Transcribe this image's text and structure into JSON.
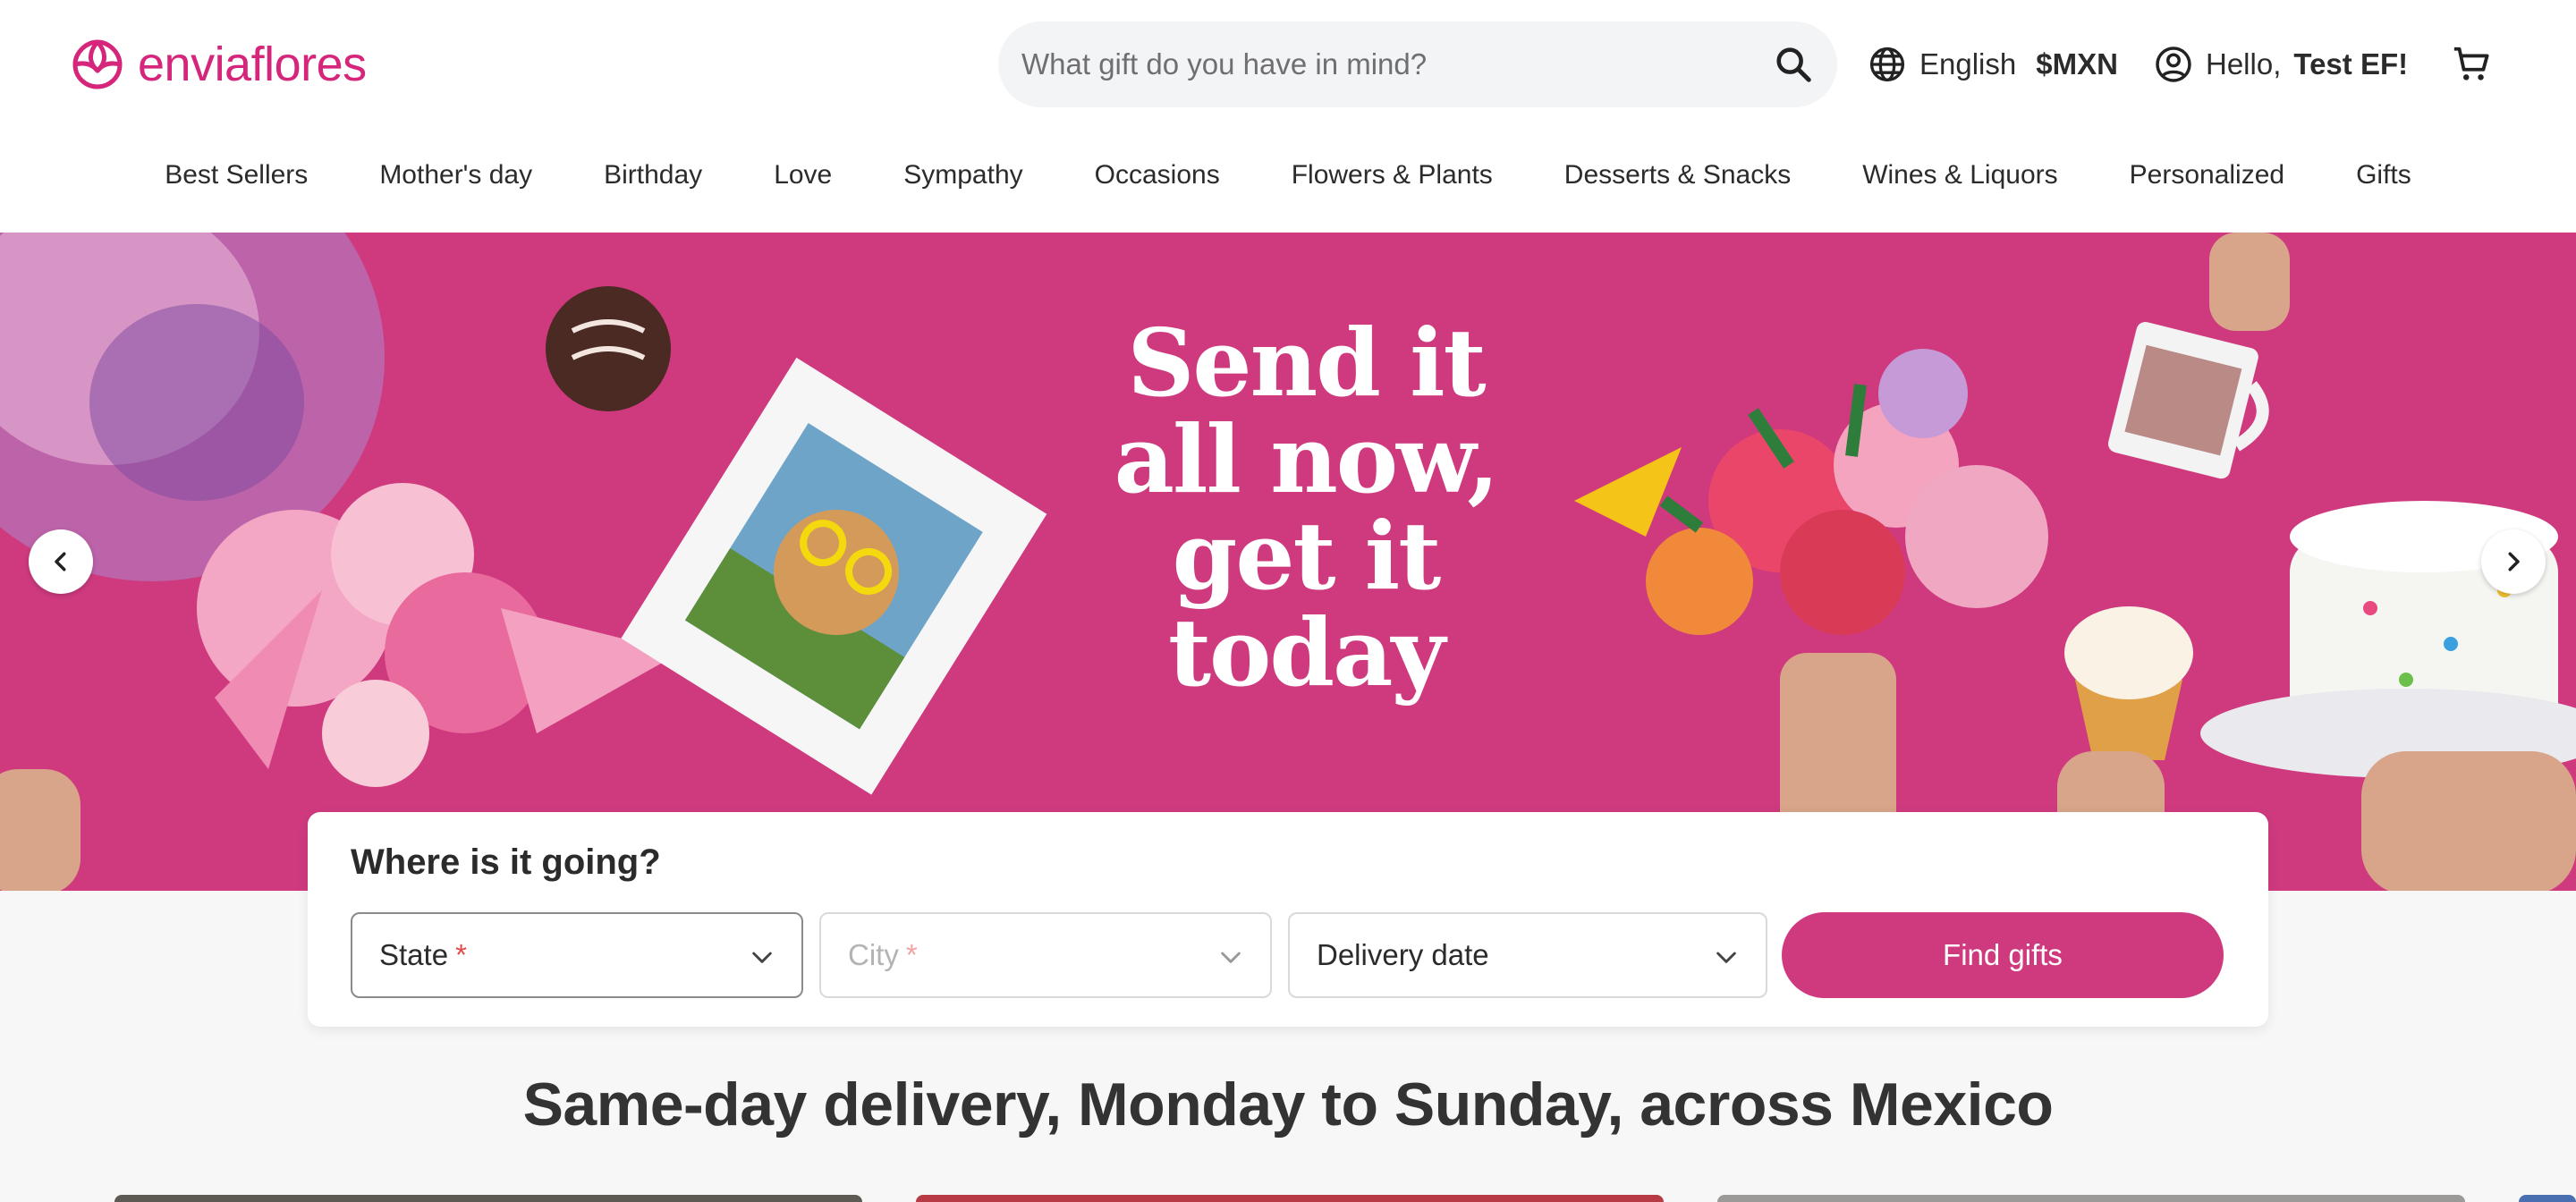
{
  "brand": {
    "name": "enviaflores",
    "color": "#d5267b"
  },
  "search": {
    "placeholder": "What gift do you have in mind?"
  },
  "locale": {
    "language": "English",
    "currency": "$MXN"
  },
  "user": {
    "greeting": "Hello,",
    "name": "Test EF!"
  },
  "nav": {
    "items": [
      "Best Sellers",
      "Mother's day",
      "Birthday",
      "Love",
      "Sympathy",
      "Occasions",
      "Flowers & Plants",
      "Desserts & Snacks",
      "Wines & Liquors",
      "Personalized",
      "Gifts"
    ]
  },
  "hero": {
    "lines": [
      "Send it",
      "all now,",
      "get it",
      "today"
    ],
    "background": "#cf3a7f"
  },
  "delivery": {
    "title": "Where is it going?",
    "state_label": "State",
    "city_label": "City",
    "required_mark": "*",
    "date_label": "Delivery date",
    "button_label": "Find gifts"
  },
  "section": {
    "title": "Same-day delivery, Monday to Sunday, across Mexico"
  },
  "colors": {
    "accent": "#cf3a7f",
    "brand": "#d5267b"
  },
  "icons": {
    "logo": "flower-logo-icon",
    "search": "search-icon",
    "language": "globe-icon",
    "account": "user-circle-icon",
    "cart": "cart-icon",
    "prev": "chevron-left-icon",
    "next": "chevron-right-icon",
    "dropdown": "chevron-down-icon"
  }
}
